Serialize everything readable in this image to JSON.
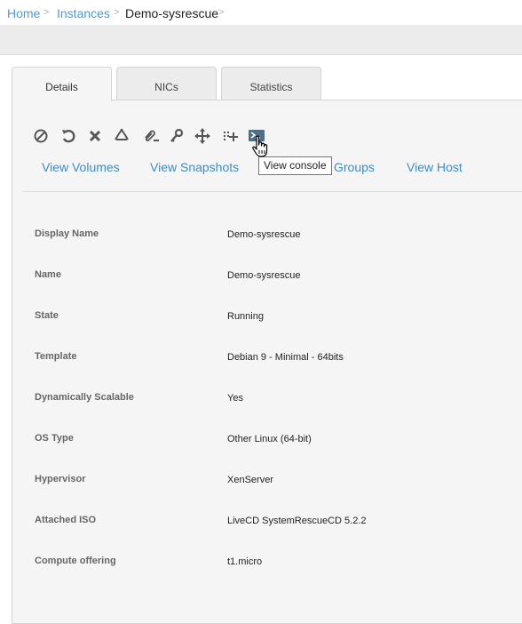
{
  "breadcrumb": {
    "items": [
      {
        "label": "Home"
      },
      {
        "label": "Instances"
      },
      {
        "label": "Demo-sysrescue"
      }
    ],
    "separator": ">"
  },
  "tabs": [
    {
      "label": "Details",
      "active": true
    },
    {
      "label": "NICs",
      "active": false
    },
    {
      "label": "Statistics",
      "active": false
    }
  ],
  "actions": {
    "icons": [
      "stop-icon",
      "reboot-icon",
      "destroy-icon",
      "recycle-icon",
      "attach-iso-icon",
      "key-icon",
      "migrate-icon",
      "scale-icon",
      "console-icon"
    ],
    "tooltip": "View console"
  },
  "view_links": {
    "volumes": "View Volumes",
    "snapshots": "View Snapshots",
    "groups": "Groups",
    "host": "View Host"
  },
  "details": {
    "rows": [
      {
        "label": "Display Name",
        "value": "Demo-sysrescue"
      },
      {
        "label": "Name",
        "value": "Demo-sysrescue"
      },
      {
        "label": "State",
        "value": "Running"
      },
      {
        "label": "Template",
        "value": "Debian 9 - Minimal - 64bits"
      },
      {
        "label": "Dynamically Scalable",
        "value": "Yes"
      },
      {
        "label": "OS Type",
        "value": "Other Linux (64-bit)"
      },
      {
        "label": "Hypervisor",
        "value": "XenServer"
      },
      {
        "label": "Attached ISO",
        "value": "LiveCD SystemRescueCD 5.2.2"
      },
      {
        "label": "Compute offering",
        "value": "t1.micro"
      }
    ]
  },
  "colors": {
    "link": "#3d8cc9",
    "panel_bg": "#f5f5f5",
    "icon": "#555555",
    "console_icon_bg": "#4e6f85"
  }
}
